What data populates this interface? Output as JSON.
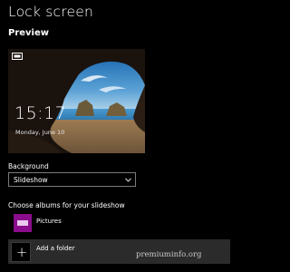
{
  "page": {
    "title": "Lock screen"
  },
  "preview": {
    "section_title": "Preview",
    "time": "15:17",
    "date": "Monday, June 10"
  },
  "background": {
    "label": "Background",
    "selected": "Slideshow"
  },
  "albums": {
    "label": "Choose albums for your slideshow",
    "items": [
      {
        "name": "Pictures",
        "thumb_color": "#8b0d8b"
      }
    ],
    "add_label": "Add a folder"
  },
  "watermark": "premiuminfo.org"
}
